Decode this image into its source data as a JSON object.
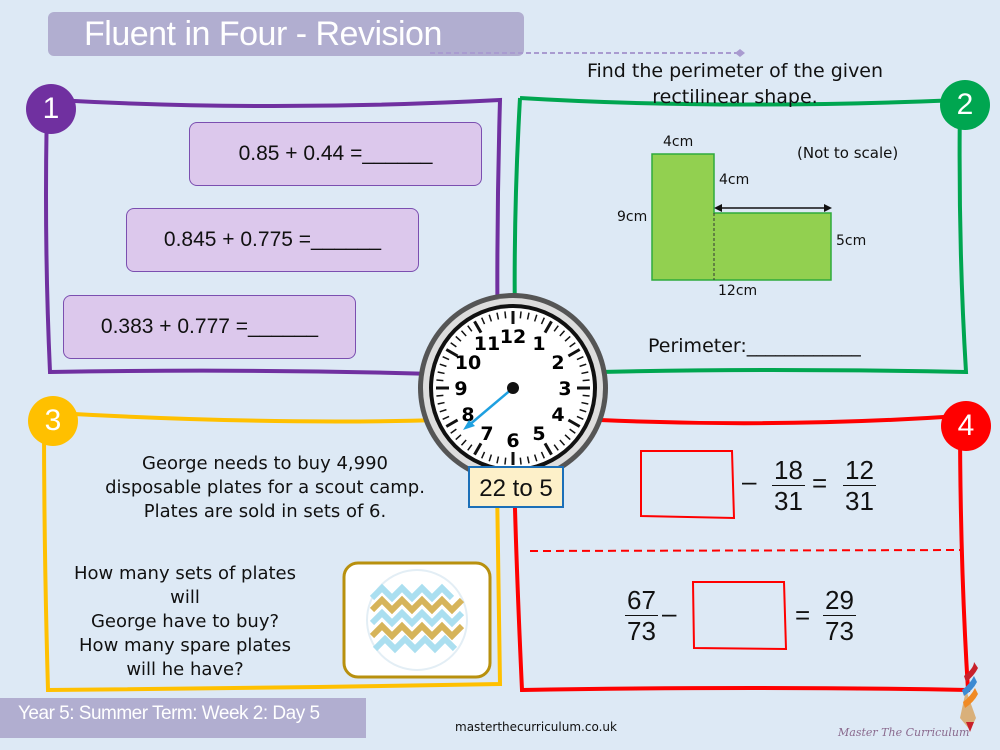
{
  "header": {
    "title": "Fluent in Four - Revision"
  },
  "question1": {
    "number": "1",
    "equations": [
      "0.85 + 0.44 =______",
      "0.845 + 0.775 =______",
      "0.383 + 0.777 =______"
    ]
  },
  "question2": {
    "number": "2",
    "prompt_line1": "Find the perimeter of the given",
    "prompt_line2": "rectilinear shape.",
    "note": "(Not to scale)",
    "labels": {
      "top": "4cm",
      "inner_vertical": "4cm",
      "left": "9cm",
      "right": "5cm",
      "bottom": "12cm"
    },
    "answer_label": "Perimeter:____________"
  },
  "clock": {
    "numbers": [
      "12",
      "1",
      "2",
      "3",
      "4",
      "5",
      "6",
      "7",
      "8",
      "9",
      "10",
      "11"
    ],
    "caption": "22 to 5"
  },
  "question3": {
    "number": "3",
    "line1": "George needs to buy 4,990",
    "line2": "disposable plates for a scout camp.",
    "line3": "Plates are sold in sets of 6.",
    "ask1": "How many sets of plates will",
    "ask2": "George have to buy?",
    "ask3": "How many spare plates",
    "ask4": "will he have?"
  },
  "question4": {
    "number": "4",
    "eq1": {
      "minus": "–",
      "f1_num": "18",
      "f1_den": "31",
      "equals": "=",
      "f2_num": "12",
      "f2_den": "31"
    },
    "eq2": {
      "f1_num": "67",
      "f1_den": "73",
      "minus": "–",
      "equals": "=",
      "f2_num": "29",
      "f2_den": "73"
    }
  },
  "footer": {
    "label": "Year 5: Summer Term: Week 2: Day 5",
    "website": "masterthecurriculum.co.uk",
    "brand": "Master The Curriculum"
  },
  "colors": {
    "q1": "#7030a0",
    "q2": "#00a650",
    "q3": "#ffc000",
    "q4": "#ff0000",
    "clock_hand": "#1ea0e0"
  }
}
